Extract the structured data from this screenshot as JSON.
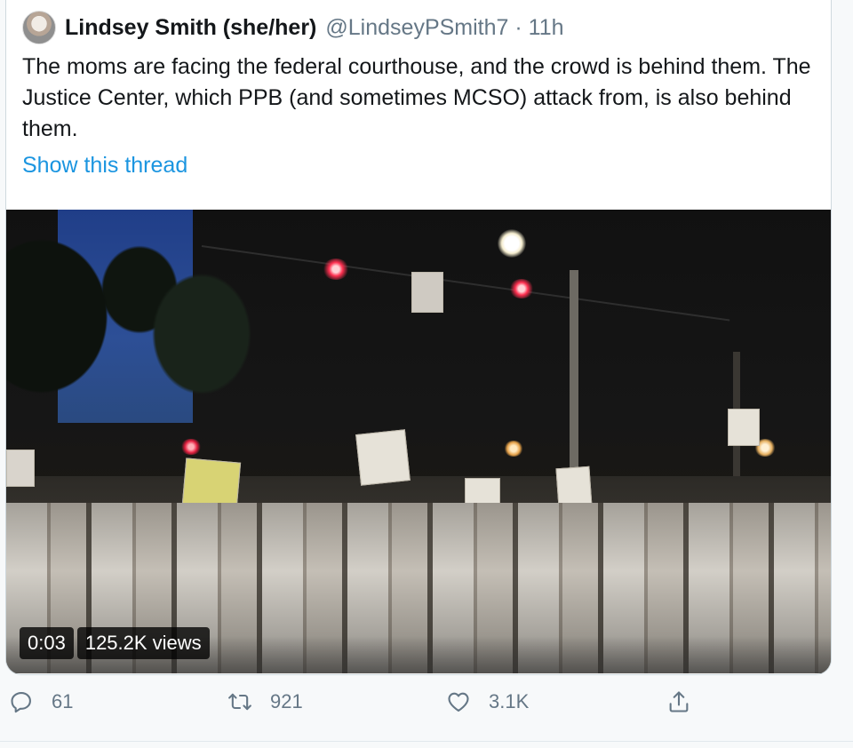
{
  "tweet": {
    "author_name": "Lindsey Smith (she/her)",
    "handle": "@LindseyPSmith7",
    "separator": "·",
    "time": "11h",
    "text": "The moms are facing the federal courthouse, and the crowd is behind them. The Justice Center, which PPB (and sometimes MCSO) attack from, is also behind them.",
    "thread_link": "Show this thread"
  },
  "video": {
    "elapsed": "0:03",
    "views": "125.2K views"
  },
  "actions": {
    "reply_count": "61",
    "retweet_count": "921",
    "like_count": "3.1K",
    "icons": [
      "reply-icon",
      "retweet-icon",
      "like-icon",
      "share-icon"
    ]
  },
  "colors": {
    "link": "#1b95e0",
    "muted": "#657786",
    "text": "#14171a"
  }
}
